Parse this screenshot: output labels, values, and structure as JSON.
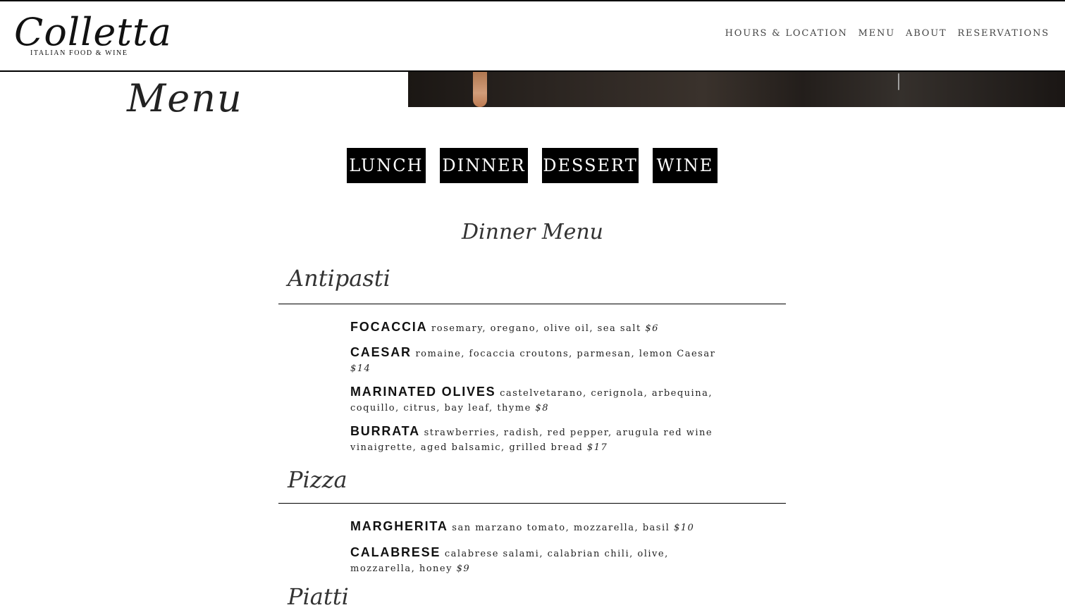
{
  "brand": {
    "name": "Colletta",
    "tagline": "ITALIAN FOOD & WINE"
  },
  "nav": [
    "HOURS & LOCATION",
    "MENU",
    "ABOUT",
    "RESERVATIONS"
  ],
  "page_title": "Menu",
  "tabs": [
    "LUNCH",
    "DINNER",
    "DESSERT",
    "WINE"
  ],
  "menu_title": "Dinner Menu",
  "sections": [
    {
      "title": "Antipasti",
      "items": [
        {
          "name": "FOCACCIA",
          "desc": "rosemary, oregano, olive oil, sea salt",
          "price": "$6"
        },
        {
          "name": "CAESAR",
          "desc": "romaine, focaccia croutons, parmesan, lemon Caesar",
          "price": "$14"
        },
        {
          "name": "MARINATED OLIVES",
          "desc": "castelvetarano, cerignola, arbequina, coquillo, citrus, bay leaf, thyme",
          "price": "$8"
        },
        {
          "name": "BURRATA",
          "desc": "strawberries, radish, red pepper, arugula red wine vinaigrette, aged balsamic, grilled bread",
          "price": "$17"
        }
      ]
    },
    {
      "title": "Pizza",
      "items": [
        {
          "name": "MARGHERITA",
          "desc": "san marzano tomato, mozzarella, basil",
          "price": "$10"
        },
        {
          "name": "CALABRESE",
          "desc": "calabrese salami, calabrian chili, olive, mozzarella, honey",
          "price": "$9"
        }
      ]
    },
    {
      "title": "Piatti"
    }
  ]
}
